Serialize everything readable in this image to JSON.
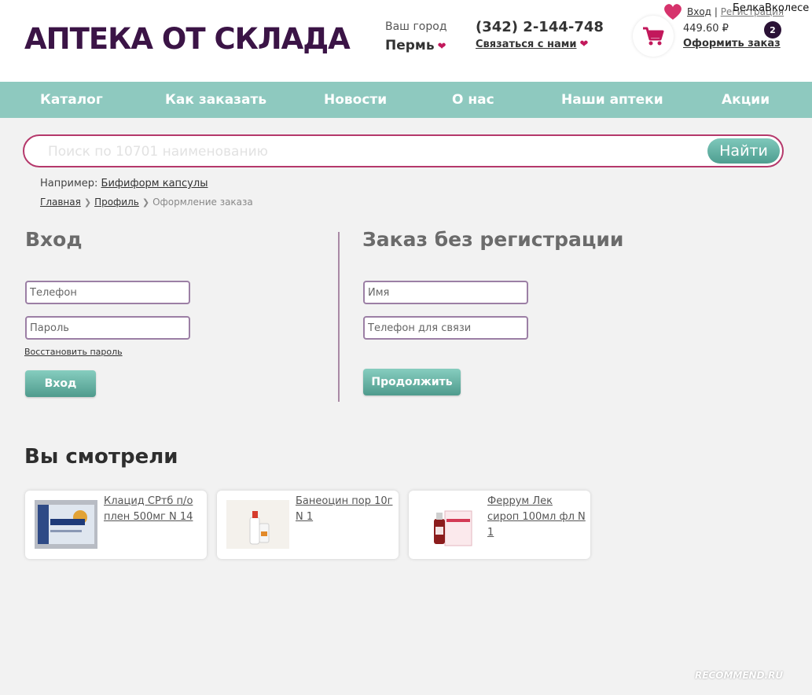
{
  "header": {
    "logo_text": "АПТЕКА ОТ СКЛАДА",
    "city_caption": "Ваш город",
    "city_value": "Пермь",
    "phone": "(342) 2-144-748",
    "contact_link": "Связаться с нами",
    "login_link": "Вход",
    "register_link": "Регистрация",
    "watermark_user": "БелкаВколесе",
    "cart_sum": "449.60 ₽",
    "cart_count": "2",
    "checkout_link": "Оформить заказ"
  },
  "nav": {
    "items": [
      "Каталог",
      "Как заказать",
      "Новости",
      "О нас",
      "Наши аптеки",
      "Акции"
    ]
  },
  "search": {
    "placeholder": "Поиск по 10701 наименованию",
    "button": "Найти",
    "example_prefix": "Например:",
    "example_link": "Бифиформ капсулы"
  },
  "breadcrumb": {
    "home": "Главная",
    "profile": "Профиль",
    "current": "Оформление заказа"
  },
  "login": {
    "title": "Вход",
    "phone_placeholder": "Телефон",
    "password_placeholder": "Пароль",
    "restore_link": "Восстановить пароль",
    "button": "Вход"
  },
  "guest": {
    "title": "Заказ без регистрации",
    "name_placeholder": "Имя",
    "phone_placeholder": "Телефон для связи",
    "button": "Продолжить"
  },
  "viewed": {
    "title": "Вы смотрели",
    "items": [
      {
        "name": "Клацид СРтб п/о плен 500мг N 14"
      },
      {
        "name": "Банеоцин пор 10г N 1"
      },
      {
        "name": "Феррум Лек сироп 100мл фл N 1"
      }
    ]
  },
  "footer_watermark": "RECOMMEND.RU",
  "colors": {
    "brand": "#3b1446",
    "accent": "#c2185b",
    "nav_bg": "#8ec9bf",
    "button_green": "#4f9b8d"
  }
}
